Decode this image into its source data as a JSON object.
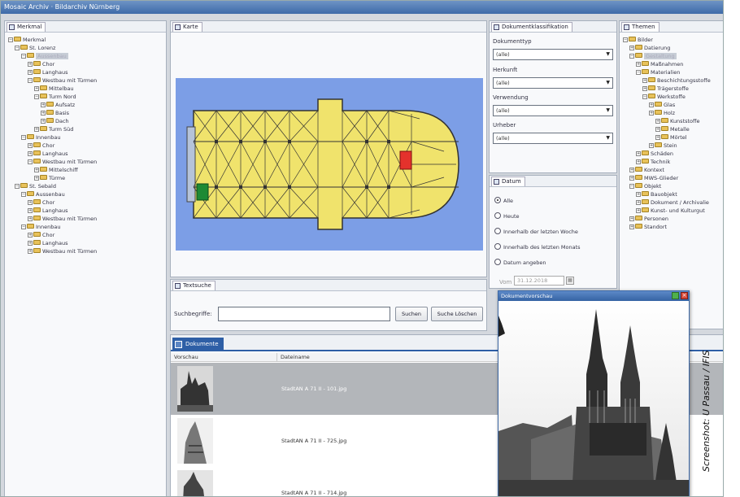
{
  "window": {
    "title": "Mosaic Archiv · Bildarchiv Nürnberg"
  },
  "left_panel": {
    "tab": "Merkmal",
    "tree": [
      {
        "pm": "⊟",
        "label": "Merkmal"
      },
      {
        "pm": "⊟",
        "label": "St. Lorenz"
      },
      {
        "pm": "⊟",
        "label": "Aussenbau"
      },
      {
        "pm": "⊞",
        "label": "Chor"
      },
      {
        "pm": "⊞",
        "label": "Langhaus"
      },
      {
        "pm": "⊟",
        "label": "Westbau mit Türmen"
      },
      {
        "pm": "⊞",
        "label": "Mittelbau"
      },
      {
        "pm": "⊟",
        "label": "Turm Nord"
      },
      {
        "pm": "⊞",
        "label": "Aufsatz"
      },
      {
        "pm": "⊞",
        "label": "Basis"
      },
      {
        "pm": "⊞",
        "label": "Dach"
      },
      {
        "pm": "⊞",
        "label": "Turm Süd"
      },
      {
        "pm": "⊟",
        "label": "Innenbau"
      },
      {
        "pm": "⊞",
        "label": "Chor"
      },
      {
        "pm": "⊞",
        "label": "Langhaus"
      },
      {
        "pm": "⊟",
        "label": "Westbau mit Türmen"
      },
      {
        "pm": "⊞",
        "label": "Mittelschiff"
      },
      {
        "pm": "⊞",
        "label": "Türme"
      },
      {
        "pm": "⊟",
        "label": "St. Sebald"
      },
      {
        "pm": "⊟",
        "label": "Aussenbau"
      },
      {
        "pm": "⊞",
        "label": "Chor"
      },
      {
        "pm": "⊞",
        "label": "Langhaus"
      },
      {
        "pm": "⊞",
        "label": "Westbau mit Türmen"
      },
      {
        "pm": "⊟",
        "label": "Innenbau"
      },
      {
        "pm": "⊞",
        "label": "Chor"
      },
      {
        "pm": "⊞",
        "label": "Langhaus"
      },
      {
        "pm": "⊞",
        "label": "Westbau mit Türmen"
      }
    ]
  },
  "map_panel": {
    "tab": "Karte"
  },
  "search_panel": {
    "tab": "Textsuche",
    "label": "Suchbegriffe:",
    "search_button": "Suchen",
    "clear_button": "Suche Löschen"
  },
  "classification_panel": {
    "tab": "Dokumentklassifikation",
    "fields": [
      {
        "label": "Dokumenttyp",
        "value": "(alle)"
      },
      {
        "label": "Herkunft",
        "value": "(alle)"
      },
      {
        "label": "Verwendung",
        "value": "(alle)"
      },
      {
        "label": "Urheber",
        "value": "(alle)"
      }
    ]
  },
  "date_panel": {
    "tab": "Datum",
    "options": [
      {
        "label": "Alle",
        "selected": true
      },
      {
        "label": "Heute",
        "selected": false
      },
      {
        "label": "Innerhalb der letzten Woche",
        "selected": false
      },
      {
        "label": "Innerhalb des letzten Monats",
        "selected": false
      },
      {
        "label": "Datum angeben",
        "selected": false
      }
    ],
    "date_from_label": "Vom",
    "date_value": "31.12.2018"
  },
  "right_panel": {
    "tab": "Themen",
    "tree": [
      {
        "pm": "⊟",
        "label": "Bilder"
      },
      {
        "pm": "⊞",
        "label": "Datierung"
      },
      {
        "pm": "⊟",
        "label": "Gestaltung"
      },
      {
        "pm": "⊞",
        "label": "Maßnahmen"
      },
      {
        "pm": "⊟",
        "label": "Materialien"
      },
      {
        "pm": "⊞",
        "label": "Beschichtungsstoffe"
      },
      {
        "pm": "⊞",
        "label": "Trägerstoffe"
      },
      {
        "pm": "⊟",
        "label": "Werkstoffe"
      },
      {
        "pm": "⊞",
        "label": "Glas"
      },
      {
        "pm": "⊞",
        "label": "Holz"
      },
      {
        "pm": "⊞",
        "label": "Kunststoffe"
      },
      {
        "pm": "⊞",
        "label": "Metalle"
      },
      {
        "pm": "⊞",
        "label": "Mörtel"
      },
      {
        "pm": "⊞",
        "label": "Stein"
      },
      {
        "pm": "⊞",
        "label": "Schäden"
      },
      {
        "pm": "⊞",
        "label": "Technik"
      },
      {
        "pm": "⊞",
        "label": "Kontext"
      },
      {
        "pm": "⊞",
        "label": "MWS-Glieder"
      },
      {
        "pm": "⊟",
        "label": "Objekt"
      },
      {
        "pm": "⊞",
        "label": "Bauobjekt"
      },
      {
        "pm": "⊞",
        "label": "Dokument / Archivalie"
      },
      {
        "pm": "⊞",
        "label": "Kunst- und Kulturgut"
      },
      {
        "pm": "⊞",
        "label": "Personen"
      },
      {
        "pm": "⊞",
        "label": "Standort"
      }
    ]
  },
  "results_panel": {
    "tab": "Dokumente",
    "columns": [
      "Vorschau",
      "Dateiname"
    ],
    "rows": [
      {
        "filename": "StadtAN A 71 II - 101.jpg"
      },
      {
        "filename": "StadtAN A 71 II - 725.jpg"
      },
      {
        "filename": "StadtAN A 71 II - 714.jpg"
      }
    ]
  },
  "preview_window": {
    "title": "Dokumentvorschau"
  },
  "credit": "Screenshot: U Passau / IFIS"
}
